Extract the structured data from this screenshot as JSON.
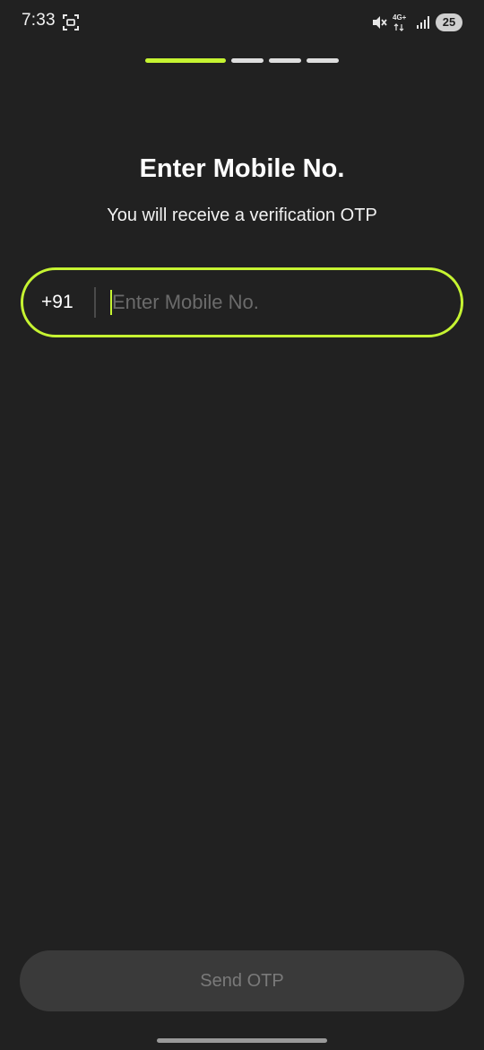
{
  "status_bar": {
    "time": "7:33",
    "network_label": "4G+",
    "battery_level": "25",
    "icons": [
      "screenshot-icon",
      "mute-icon",
      "network-icon",
      "signal-icon",
      "battery-icon"
    ]
  },
  "progress": {
    "total_steps": 4,
    "current_step": 1,
    "active_color": "#c6f432",
    "inactive_color": "#dedede"
  },
  "header": {
    "title": "Enter Mobile No.",
    "subtitle": "You will receive a verification OTP"
  },
  "phone_input": {
    "country_code": "+91",
    "value": "",
    "placeholder": "Enter Mobile No.",
    "focused": true
  },
  "actions": {
    "send_otp_label": "Send OTP",
    "send_otp_enabled": false
  },
  "colors": {
    "background": "#212121",
    "accent": "#c6f432",
    "button_disabled_bg": "#3a3a3a",
    "button_disabled_text": "#7a7a7a"
  }
}
